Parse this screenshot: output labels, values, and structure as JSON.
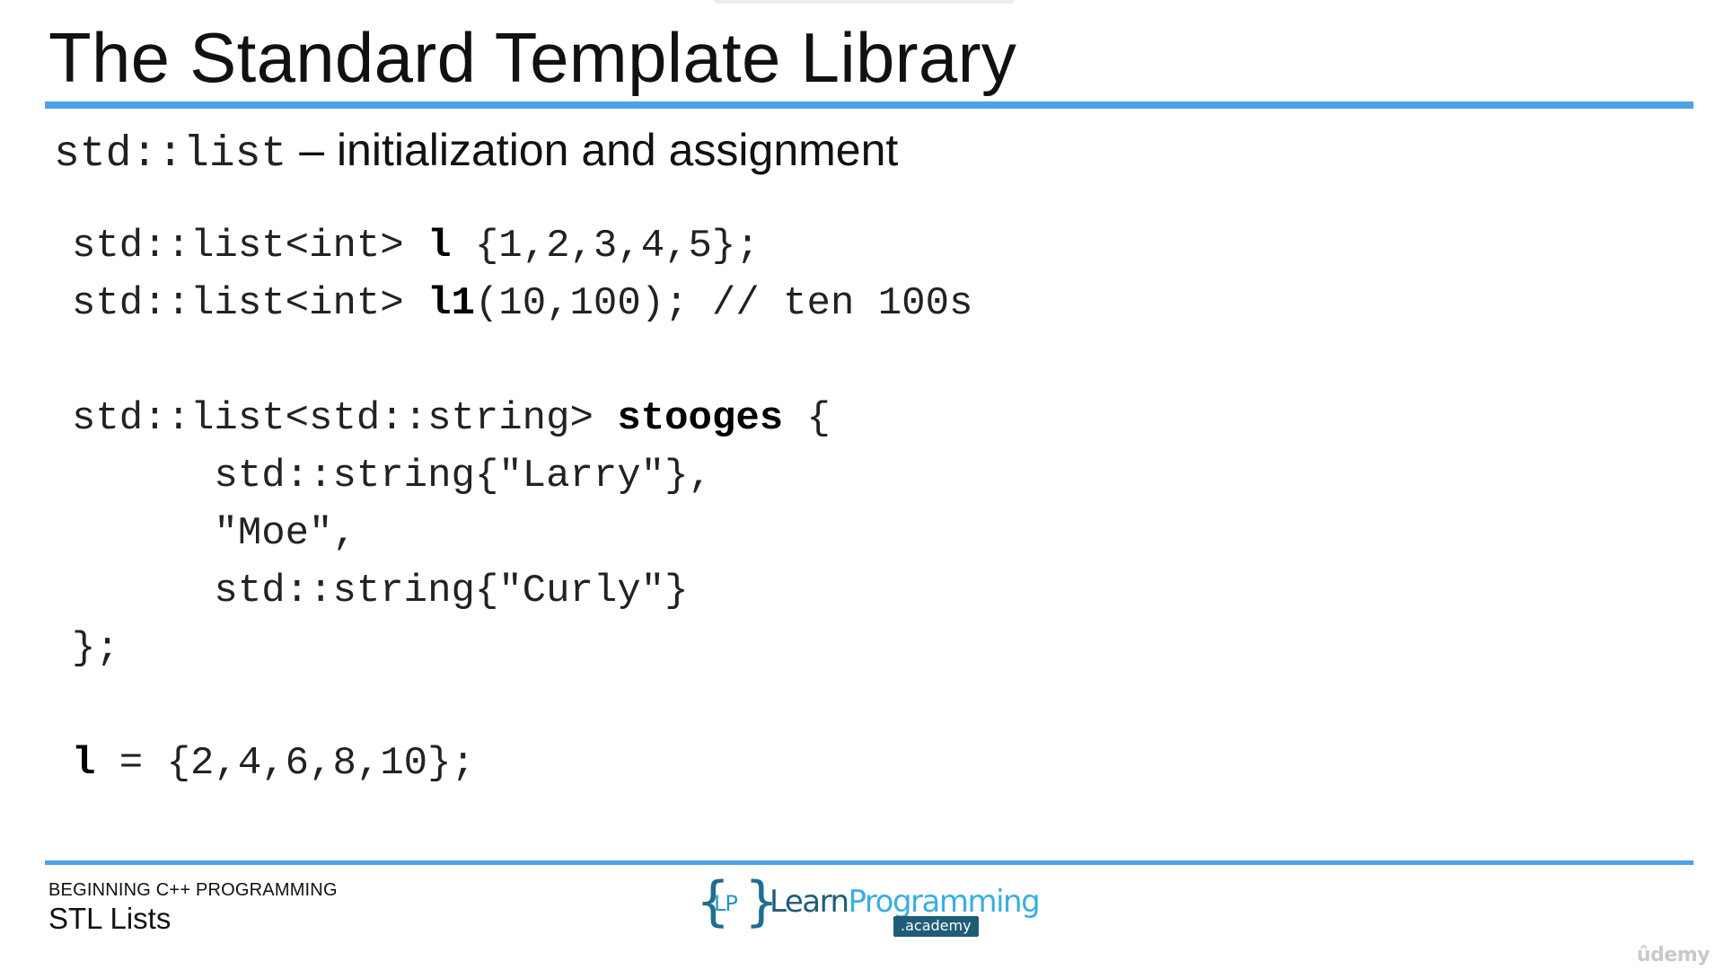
{
  "slide": {
    "title": "The Standard Template Library",
    "subtitle": {
      "code": "std::list",
      "text": "– initialization and assignment"
    },
    "code_lines": [
      [
        {
          "t": "std::list<int> "
        },
        {
          "t": "l",
          "b": true
        },
        {
          "t": " {1,2,3,4,5};"
        }
      ],
      [
        {
          "t": "std::list<int> "
        },
        {
          "t": "l1",
          "b": true
        },
        {
          "t": "(10,100); // ten 100s"
        }
      ],
      [],
      [
        {
          "t": "std::list<std::string> "
        },
        {
          "t": "stooges",
          "b": true
        },
        {
          "t": " {"
        }
      ],
      [
        {
          "t": "      std::string{\"Larry\"},"
        }
      ],
      [
        {
          "t": "      \"Moe\","
        }
      ],
      [
        {
          "t": "      std::string{\"Curly\"}"
        }
      ],
      [
        {
          "t": "};"
        }
      ],
      [],
      [
        {
          "t": "l",
          "b": true
        },
        {
          "t": " = {2,4,6,8,10};"
        }
      ]
    ]
  },
  "footer": {
    "course": "BEGINNING C++ PROGRAMMING",
    "lecture": "STL Lists"
  },
  "logo": {
    "brace_left": "{",
    "initials": "LP",
    "brace_right": "}",
    "name_part1": "Learn",
    "name_part2": "Programming",
    "badge": ".academy"
  },
  "watermark": "ûdemy",
  "colors": {
    "accent_rule": "#4ea0e8",
    "logo_dark": "#1f5c78",
    "logo_light": "#3aaee0"
  }
}
